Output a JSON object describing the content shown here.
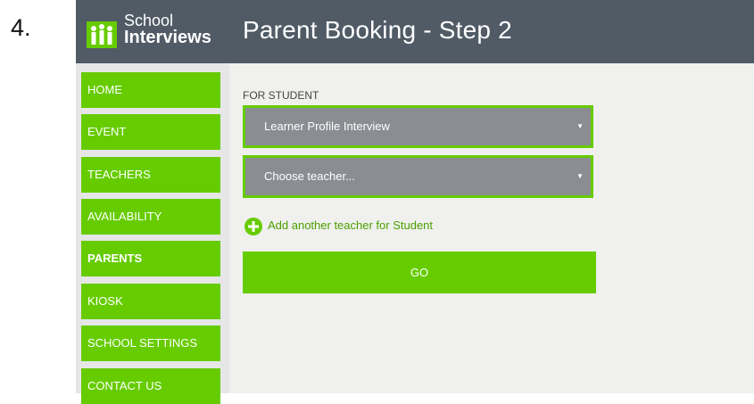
{
  "step_number": "4.",
  "header": {
    "logo_line1": "School",
    "logo_line2": "Interviews",
    "title": "Parent Booking - Step 2",
    "background": "#505b66"
  },
  "sidebar": {
    "items": [
      {
        "label": "HOME"
      },
      {
        "label": "EVENT"
      },
      {
        "label": "TEACHERS"
      },
      {
        "label": "AVAILABILITY"
      },
      {
        "label": "PARENTS",
        "active": true
      },
      {
        "label": "KIOSK"
      },
      {
        "label": "SCHOOL SETTINGS"
      },
      {
        "label": "CONTACT US"
      }
    ],
    "item_color": "#66cc00"
  },
  "main": {
    "for_label": "FOR STUDENT",
    "interview_select": {
      "value": "Learner Profile Interview",
      "icon": "caret-down-icon"
    },
    "teacher_select": {
      "value": "Choose teacher...",
      "icon": "caret-down-icon"
    },
    "add_teacher": {
      "label": "Add another teacher for Student",
      "icon": "plus-circle-icon"
    },
    "go_button": {
      "label": "GO"
    }
  },
  "colors": {
    "accent_green": "#66cc00",
    "select_grey": "#8a8e93",
    "panel_bg": "#f0f0ee",
    "sidebar_bg": "#e6e6e6"
  }
}
